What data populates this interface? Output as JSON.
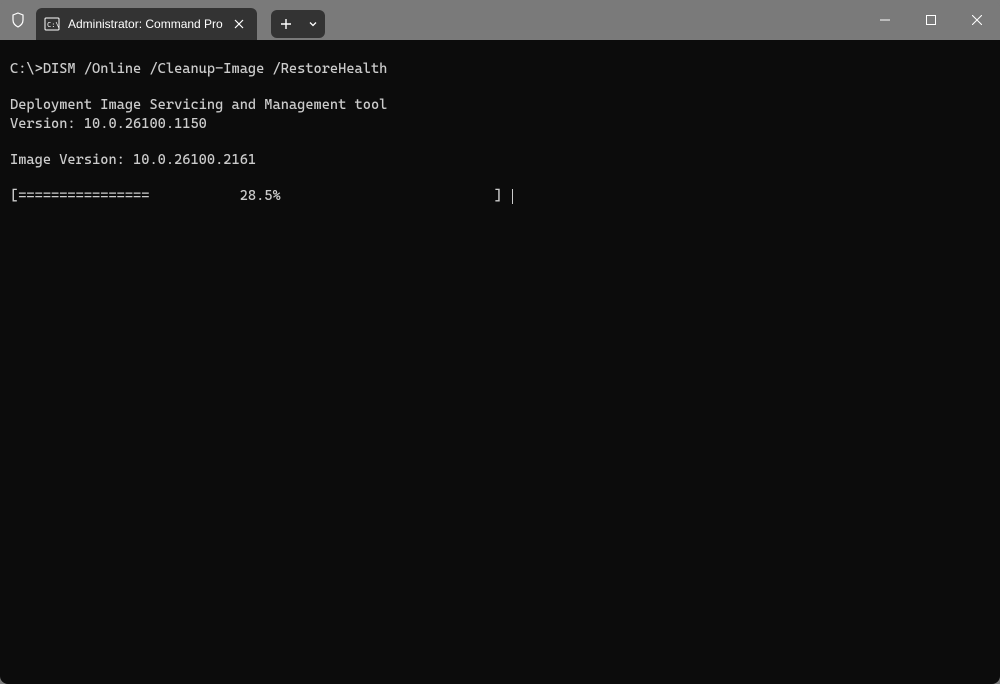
{
  "tab": {
    "title": "Administrator: Command Pro"
  },
  "terminal": {
    "prompt": "C:\\>",
    "command": "DISM /Online /Cleanup-Image /RestoreHealth",
    "line1": "Deployment Image Servicing and Management tool",
    "line2": "Version: 10.0.26100.1150",
    "line3": "Image Version: 10.0.26100.2161",
    "progress": "[================           28.5%                          ] "
  }
}
